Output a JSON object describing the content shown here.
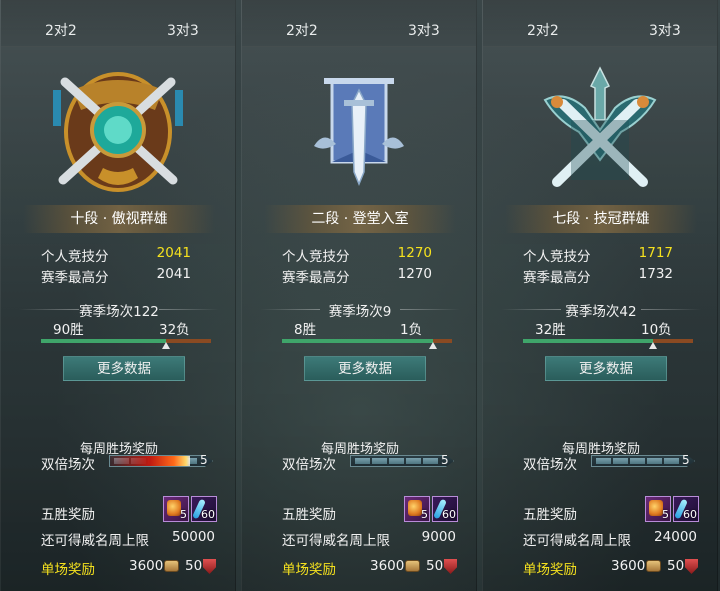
{
  "colors": {
    "highlight_score": "#f5e11e",
    "single_reward_label": "#f5e11e",
    "win_bar": "#3fa56a",
    "loss_bar": "#8a4a22",
    "button": "#2f6866"
  },
  "panels": [
    {
      "tab_left": "2对2",
      "tab_right": "3对3",
      "badge_icon": "gold-crossed-swords-emblem-icon",
      "rank": "十段 · 傲视群雄",
      "personal_score_label": "个人竞技分",
      "personal_score": "2041",
      "season_best_label": "赛季最高分",
      "season_best": "2041",
      "season_matches": "赛季场次122",
      "wins": "90胜",
      "losses": "32负",
      "win_ratio": 0.738,
      "more_button": "更多数据",
      "weekly_title": "每周胜场奖励",
      "double_label": "双倍场次",
      "double_count": "5",
      "double_progress_lit": true,
      "five_win_label": "五胜奖励",
      "item1_count": "5",
      "item2_count": "60",
      "cap_label": "还可得威名周上限",
      "cap_value": "50000",
      "single_label": "单场奖励",
      "single_coin": "3600",
      "single_shield": "50"
    },
    {
      "tab_left": "2对2",
      "tab_right": "3对3",
      "badge_icon": "silver-sword-banner-emblem-icon",
      "rank": "二段 · 登堂入室",
      "personal_score_label": "个人竞技分",
      "personal_score": "1270",
      "season_best_label": "赛季最高分",
      "season_best": "1270",
      "season_matches": "赛季场次9",
      "wins": "8胜",
      "losses": "1负",
      "win_ratio": 0.889,
      "more_button": "更多数据",
      "weekly_title": "每周胜场奖励",
      "double_label": "双倍场次",
      "double_count": "5",
      "double_progress_lit": false,
      "five_win_label": "五胜奖励",
      "item1_count": "5",
      "item2_count": "60",
      "cap_label": "还可得威名周上限",
      "cap_value": "9000",
      "single_label": "单场奖励",
      "single_coin": "3600",
      "single_shield": "50"
    },
    {
      "tab_left": "2对2",
      "tab_right": "3对3",
      "badge_icon": "teal-crossed-swords-emblem-icon",
      "rank": "七段 · 技冠群雄",
      "personal_score_label": "个人竞技分",
      "personal_score": "1717",
      "season_best_label": "赛季最高分",
      "season_best": "1732",
      "season_matches": "赛季场次42",
      "wins": "32胜",
      "losses": "10负",
      "win_ratio": 0.762,
      "more_button": "更多数据",
      "weekly_title": "每周胜场奖励",
      "double_label": "双倍场次",
      "double_count": "5",
      "double_progress_lit": false,
      "five_win_label": "五胜奖励",
      "item1_count": "5",
      "item2_count": "60",
      "cap_label": "还可得威名周上限",
      "cap_value": "24000",
      "single_label": "单场奖励",
      "single_coin": "3600",
      "single_shield": "50"
    }
  ]
}
